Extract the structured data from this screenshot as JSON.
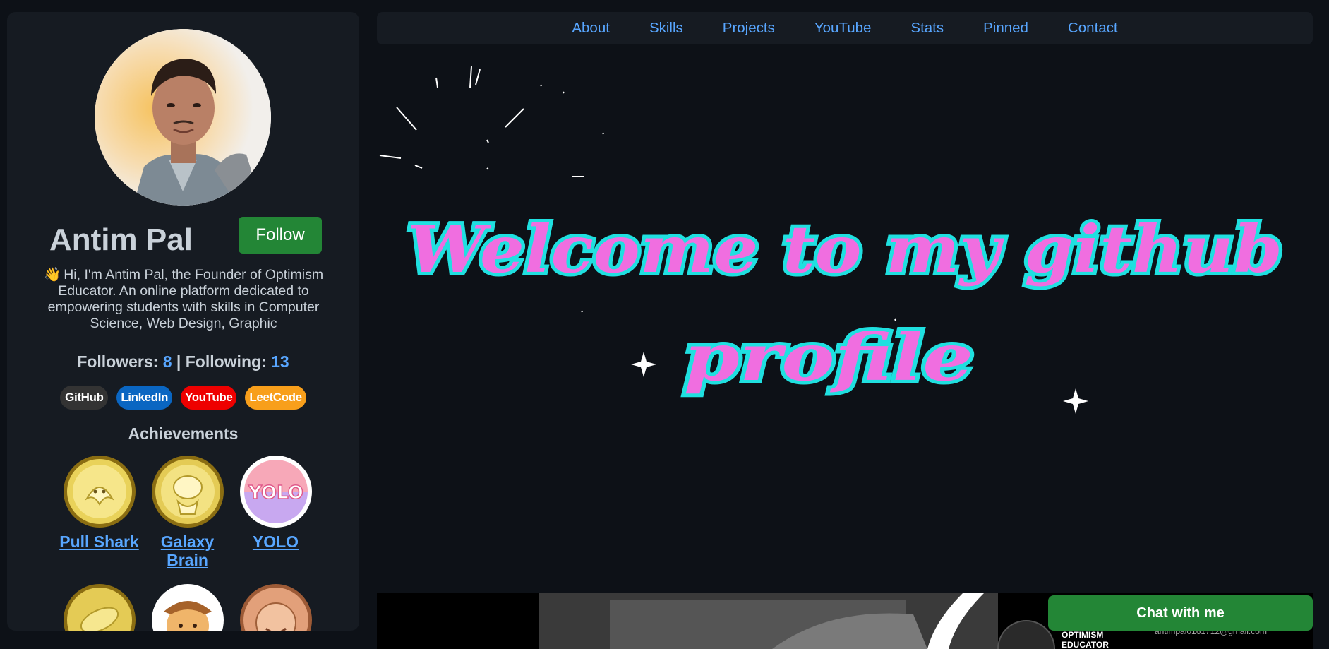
{
  "profile": {
    "name": "Antim Pal",
    "follow_label": "Follow",
    "bio_emoji": "👋",
    "bio": "Hi, I'm Antim Pal, the Founder of Optimism Educator. An online platform dedicated to empowering students with skills in Computer Science, Web Design, Graphic",
    "followers_label": "Followers:",
    "followers_count": "8",
    "separator": "|",
    "following_label": "Following:",
    "following_count": "13"
  },
  "socials": [
    {
      "label": "GitHub",
      "color": "#333333"
    },
    {
      "label": "LinkedIn",
      "color": "#0a66c2"
    },
    {
      "label": "YouTube",
      "color": "#ee0000"
    },
    {
      "label": "LeetCode",
      "color": "#f89f1b"
    }
  ],
  "achievements": {
    "title": "Achievements",
    "badges": [
      {
        "label": "Pull Shark",
        "icon": "pull-shark-badge-icon"
      },
      {
        "label": "Galaxy Brain",
        "icon": "galaxy-brain-badge-icon"
      },
      {
        "label": "YOLO",
        "icon": "yolo-badge-icon",
        "badge_text": "YOLO"
      },
      {
        "label": "",
        "icon": "pair-extraordinaire-badge-icon"
      },
      {
        "label": "",
        "icon": "quickdraw-badge-icon"
      },
      {
        "label": "",
        "icon": "starstruck-badge-icon"
      }
    ]
  },
  "nav": {
    "links": [
      "About",
      "Skills",
      "Projects",
      "YouTube",
      "Stats",
      "Pinned",
      "Contact"
    ]
  },
  "hero": {
    "line1": "Welcome to my github",
    "line2": "profile",
    "text_color": "#f06ee0",
    "outline_color": "#1fe0e0"
  },
  "banner": {
    "brand_line1": "OPTIMISM",
    "brand_line2": "EDUCATOR",
    "email": "antimpal0161712@gmail.com"
  },
  "chat": {
    "label": "Chat with me"
  },
  "colors": {
    "page_bg": "#0d1117",
    "panel_bg": "#161b22",
    "accent": "#58a6ff",
    "button_green": "#238636"
  }
}
